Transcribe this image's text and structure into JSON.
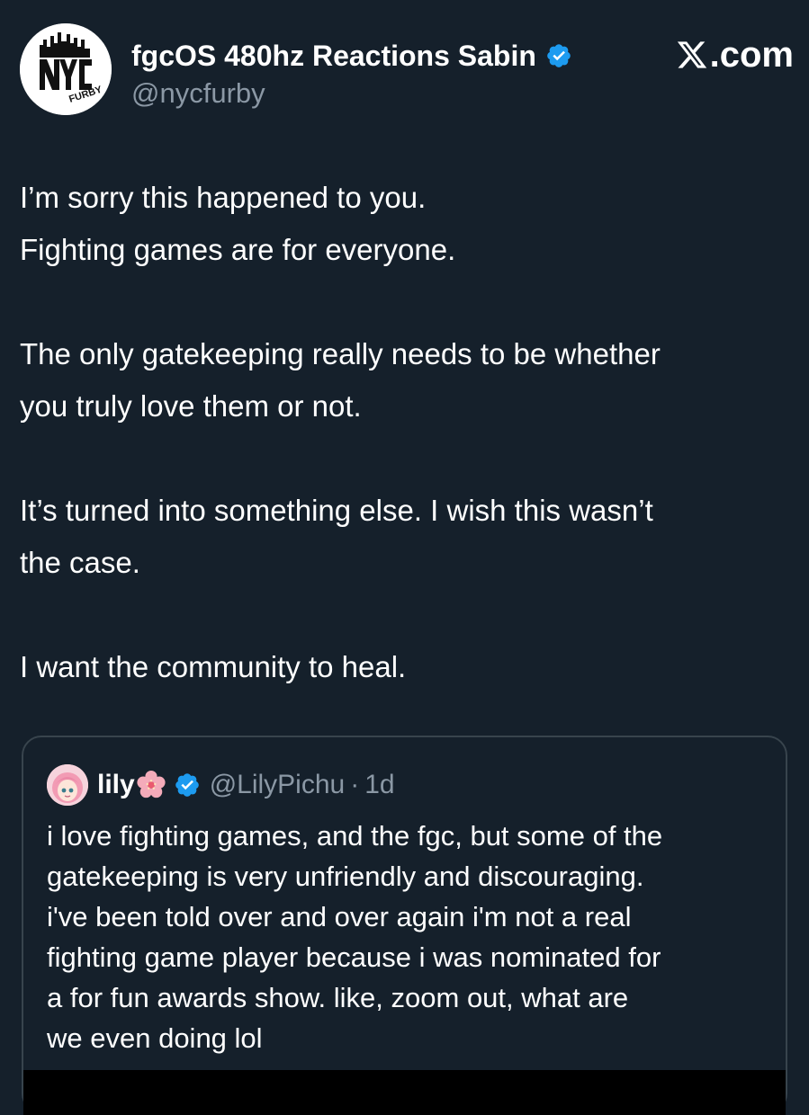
{
  "post": {
    "author": {
      "display_name": "fgcOS 480hz Reactions Sabin",
      "handle": "@nycfurby",
      "verified": true,
      "avatar_icon": "nyc-furby-logo-avatar"
    },
    "site_logo": {
      "icon": "x-logo-icon",
      "text": ".com"
    },
    "body_lines": [
      "I’m sorry this happened to you.",
      "Fighting games are for everyone.",
      "The only gatekeeping really needs to be whether",
      "you truly love them or not.",
      "It’s turned into something else. I wish this wasn’t",
      "the case.",
      "I want the community to heal."
    ]
  },
  "quote": {
    "author": {
      "display_name": "lily",
      "emoji": "cherry-blossom-icon",
      "verified": true,
      "handle": "@LilyPichu",
      "separator": "·",
      "time": "1d",
      "avatar_icon": "anime-girl-avatar"
    },
    "text_lines": [
      "i love fighting games, and the fgc, but some of the",
      "gatekeeping is very unfriendly and discouraging.",
      "i've been told over and over again i'm not a real",
      "fighting game player because i was nominated for",
      "a for fun awards show. like, zoom out, what are",
      "we even doing lol"
    ]
  },
  "colors": {
    "background": "#15202b",
    "text": "#ffffff",
    "secondary_text": "#8b98a5",
    "verified_blue": "#1d9bf0",
    "border": "#38444d"
  }
}
